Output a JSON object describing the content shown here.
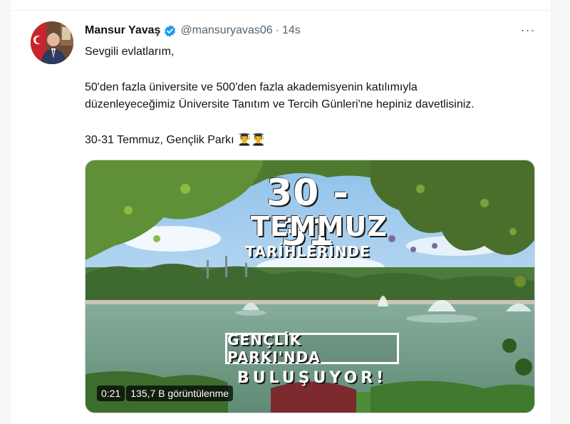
{
  "tweet": {
    "author_name": "Mansur Yavaş",
    "handle": "@mansuryavas06",
    "separator": "·",
    "time": "14s",
    "more_label": "···",
    "lines": [
      "Sevgili evlatlarım,",
      "50'den fazla üniversite ve 500'den fazla akademisyenin katılımıyla",
      "düzenleyeceğimiz Üniversite Tanıtım ve Tercih Günleri'ne hepiniz davetlisiniz.",
      "30-31 Temmuz, Gençlik Parkı 👨‍🎓👨‍🎓"
    ]
  },
  "media": {
    "overlay": {
      "days": "30 - 31",
      "month": "TEMMUZ",
      "dates_word": "TARİHLERİNDE",
      "place": "GENÇLİK PARKI'NDA",
      "meeting": "BULUŞUYOR!"
    },
    "video_time": "0:21",
    "view_count": "135,7 B görüntülenme"
  },
  "colors": {
    "verified": "#1d9bf0",
    "secondary_text": "#536471",
    "border": "#cfd9de"
  },
  "icons": {
    "verified": "verified-badge-icon",
    "more": "more-dots-icon"
  }
}
